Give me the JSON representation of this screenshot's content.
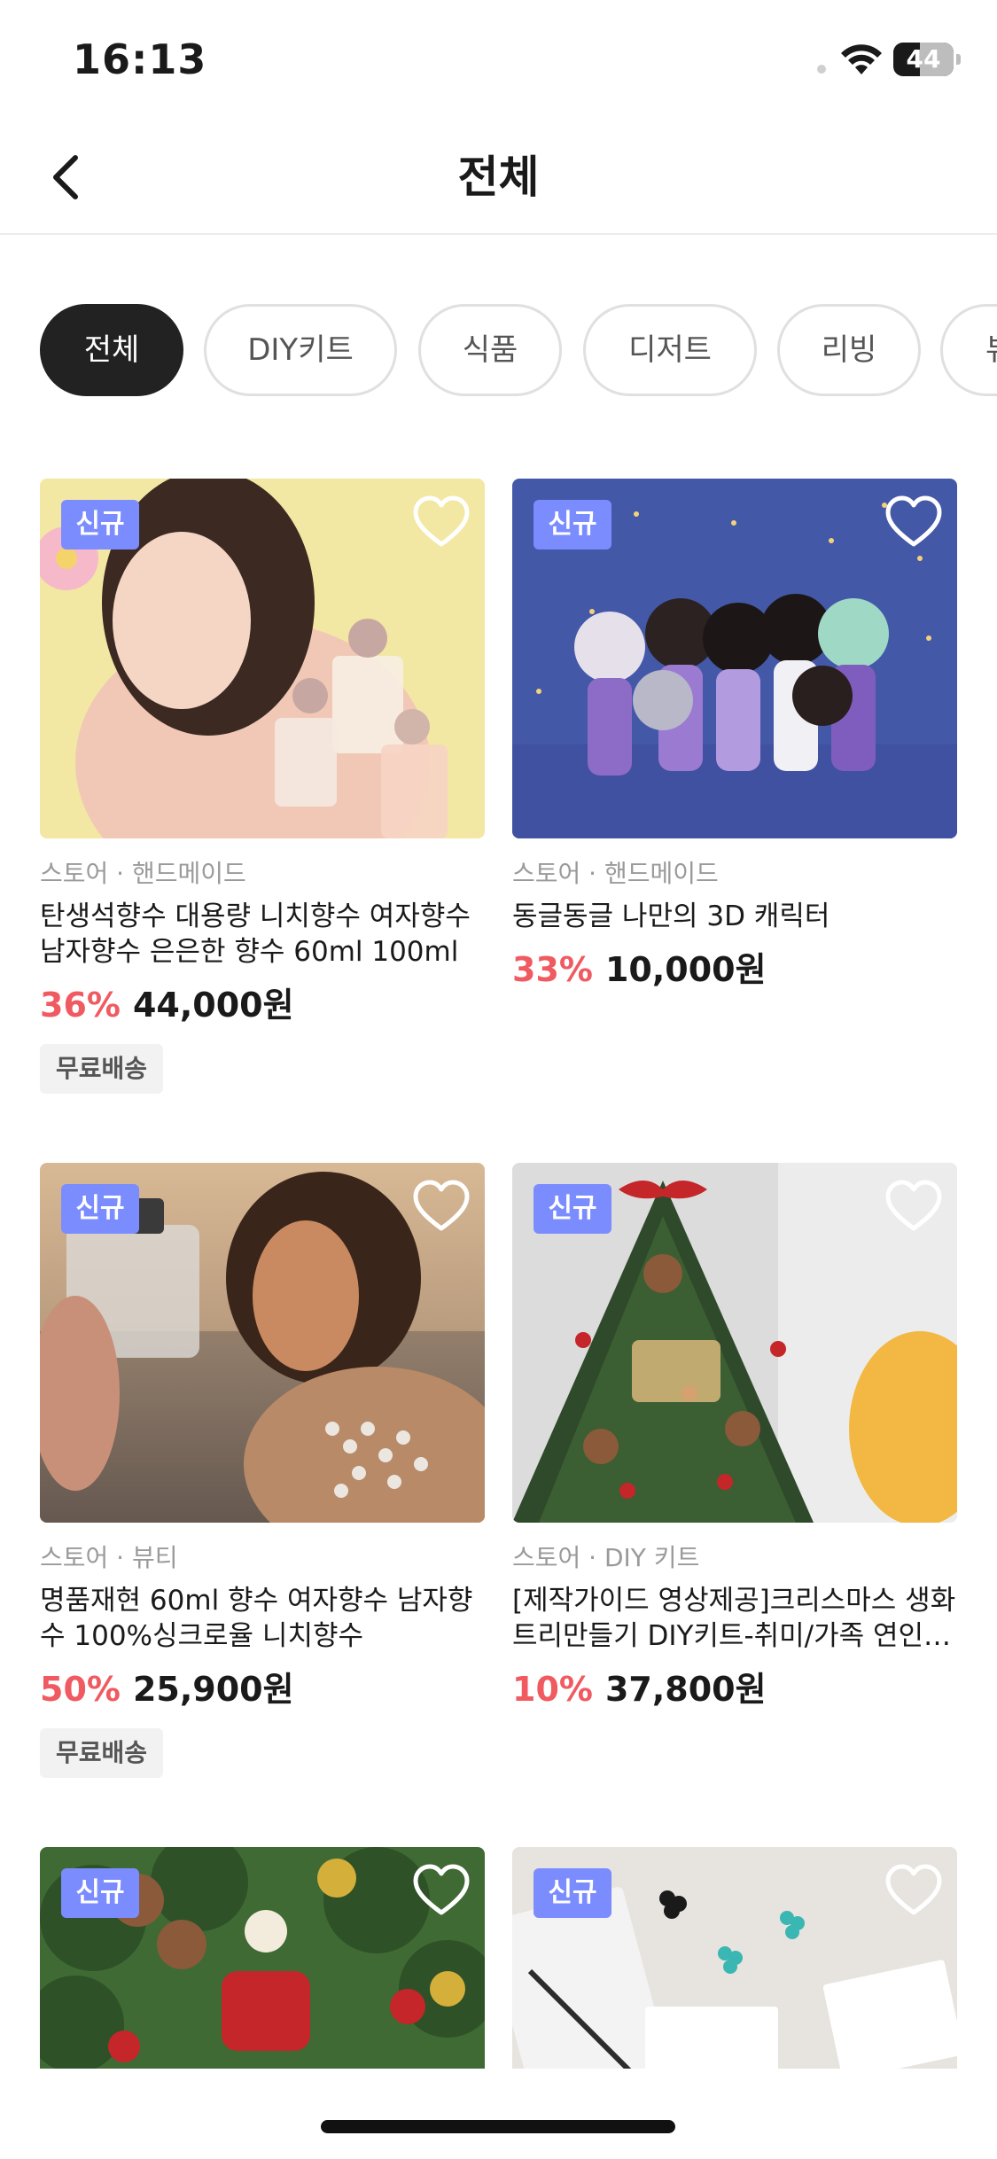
{
  "status_bar": {
    "time": "16:13",
    "battery": "44",
    "battery_level": 0.44
  },
  "header": {
    "title": "전체",
    "back_icon": "chevron-left-icon"
  },
  "categories": [
    {
      "label": "전체",
      "active": true
    },
    {
      "label": "DIY키트",
      "active": false
    },
    {
      "label": "식품",
      "active": false
    },
    {
      "label": "디저트",
      "active": false
    },
    {
      "label": "리빙",
      "active": false
    },
    {
      "label": "뷰",
      "active": false
    }
  ],
  "products": [
    {
      "badge": "신규",
      "store": "스토어 · 핸드메이드",
      "name": "탄생석향수 대용량 니치향수 여자향수 남자향수 은은한 향수 60ml 100ml",
      "discount": "36%",
      "price": "44,000원",
      "shipping": "무료배송"
    },
    {
      "badge": "신규",
      "store": "스토어 · 핸드메이드",
      "name": "동글동글 나만의 3D 캐릭터",
      "discount": "33%",
      "price": "10,000원",
      "shipping": ""
    },
    {
      "badge": "신규",
      "store": "스토어 · 뷰티",
      "name": "명품재현 60ml 향수 여자향수 남자향수 100%싱크로율 니치향수",
      "discount": "50%",
      "price": "25,900원",
      "shipping": "무료배송"
    },
    {
      "badge": "신규",
      "store": "스토어 · DIY 키트",
      "name": "[제작가이드 영상제공]크리스마스 생화트리만들기 DIY키트-취미/가족 연인…",
      "discount": "10%",
      "price": "37,800원",
      "shipping": ""
    },
    {
      "badge": "신규"
    },
    {
      "badge": "신규"
    }
  ],
  "colors": {
    "accent": "#7b8cff",
    "discount": "#f05a61",
    "chip_active": "#222222"
  }
}
